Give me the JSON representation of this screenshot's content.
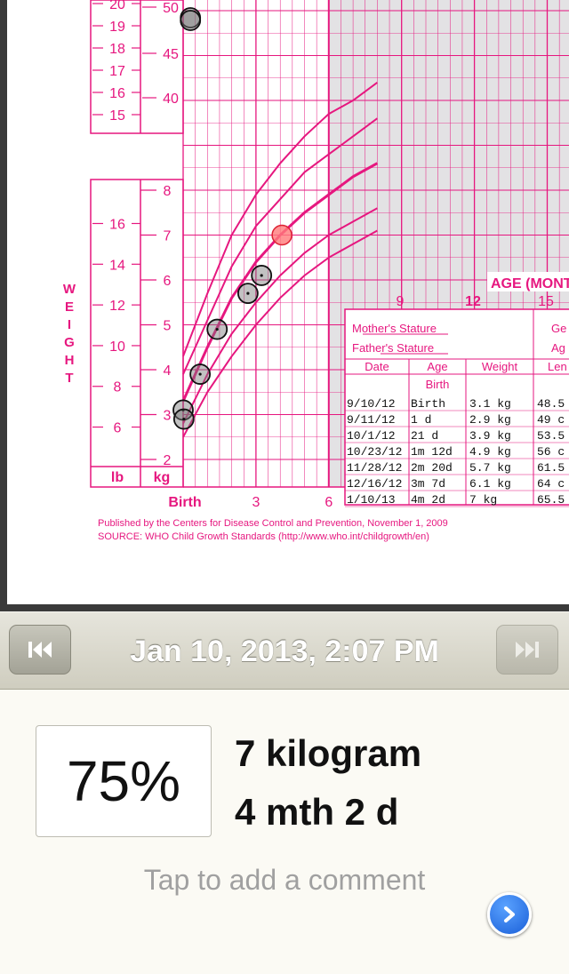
{
  "chart": {
    "weight_label": "WEIGHT",
    "lb_label": "lb",
    "kg_label": "kg",
    "age_label": "AGE (MONT",
    "upper_kg_ticks": [
      "50",
      "45",
      "40"
    ],
    "upper_lb_ticks": [
      "20",
      "19",
      "18",
      "17",
      "16",
      "15"
    ],
    "lower_kg_ticks": [
      "8",
      "7",
      "6",
      "5",
      "4",
      "3",
      "2"
    ],
    "lower_lb_ticks": [
      "16",
      "14",
      "12",
      "10",
      "8",
      "6"
    ],
    "x_ticks_bottom": [
      "Birth",
      "3",
      "6"
    ],
    "x_ticks_top": [
      "9",
      "12",
      "15"
    ],
    "mothers_stature": "Mother's Stature",
    "fathers_stature": "Father's Stature",
    "right_cut_labels": [
      "Ge",
      "Ag",
      "Len"
    ],
    "col_headers": [
      "Date",
      "Age",
      "Weight"
    ],
    "birth_label": "Birth",
    "rows": [
      {
        "date": "9/10/12",
        "age": "Birth",
        "weight": "3.1 kg",
        "len": "48.5"
      },
      {
        "date": "9/11/12",
        "age": "1 d",
        "weight": "2.9 kg",
        "len": "49 c"
      },
      {
        "date": "10/1/12",
        "age": "21 d",
        "weight": "3.9 kg",
        "len": "53.5"
      },
      {
        "date": "10/23/12",
        "age": "1m 12d",
        "weight": "4.9 kg",
        "len": "56 c"
      },
      {
        "date": "11/28/12",
        "age": "2m 20d",
        "weight": "5.7 kg",
        "len": "61.5"
      },
      {
        "date": "12/16/12",
        "age": "3m 7d",
        "weight": "6.1 kg",
        "len": "64 c"
      },
      {
        "date": "1/10/13",
        "age": "4m 2d",
        "weight": "7 kg",
        "len": "65.5"
      }
    ],
    "published": "Published by the Centers for Disease Control and Prevention, November 1, 2009",
    "source": "SOURCE:  WHO Child Growth Standards (http://www.who.int/childgrowth/en)",
    "magenta": "#e6177f",
    "highlight_color": "#ff7a7a"
  },
  "chart_data": {
    "type": "scatter",
    "xlabel": "AGE (MONT",
    "ylabel": "WEIGHT",
    "x_unit": "months",
    "y_unit": "kg",
    "xlim": [
      0,
      6
    ],
    "ylim": [
      2,
      8
    ],
    "series": [
      {
        "name": "",
        "x": [
          0,
          0.03,
          0.7,
          1.4,
          2.67,
          3.23
        ],
        "y": [
          3.1,
          2.9,
          3.9,
          4.9,
          5.7,
          6.1
        ]
      },
      {
        "name": "",
        "x": [
          4.07
        ],
        "y": [
          7
        ]
      }
    ],
    "percentile_curves_kg": {
      "x": [
        0,
        1,
        2,
        3,
        4,
        5,
        6,
        7,
        8
      ],
      "p3": [
        2.5,
        3.5,
        4.3,
        5.0,
        5.6,
        6.1,
        6.5,
        6.8,
        7.1
      ],
      "p15": [
        2.8,
        3.9,
        4.8,
        5.5,
        6.1,
        6.6,
        7.0,
        7.3,
        7.6
      ],
      "p50": [
        3.3,
        4.5,
        5.6,
        6.4,
        7.0,
        7.5,
        7.9,
        8.3,
        8.6
      ],
      "p85": [
        3.9,
        5.1,
        6.3,
        7.2,
        7.8,
        8.4,
        8.8,
        9.2,
        9.6
      ],
      "p97": [
        4.3,
        5.7,
        7.0,
        7.9,
        8.6,
        9.2,
        9.7,
        10.0,
        10.4
      ]
    }
  },
  "toolbar": {
    "date_title": "Jan 10, 2013, 2:07 PM",
    "prev_icon": "skip-back-icon",
    "next_icon": "skip-forward-icon"
  },
  "measurement": {
    "percentile": "75%",
    "weight": "7 kilogram",
    "age": "4 mth 2 d",
    "comment_placeholder": "Tap to add a comment",
    "go_icon": "chevron-right-icon"
  }
}
